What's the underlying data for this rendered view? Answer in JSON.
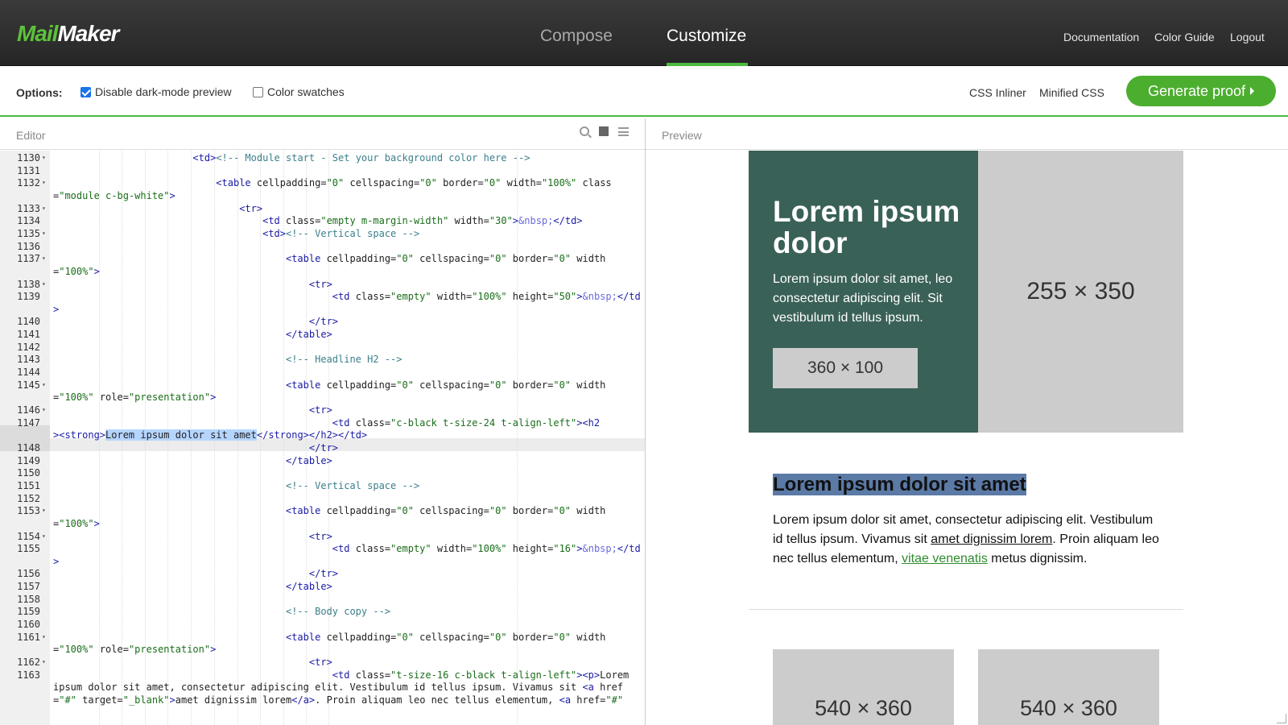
{
  "app": {
    "logo_part1": "Mail",
    "logo_part2": "Maker"
  },
  "nav": {
    "tabs": [
      {
        "label": "Compose",
        "active": false
      },
      {
        "label": "Customize",
        "active": true
      }
    ],
    "links": [
      "Documentation",
      "Color Guide",
      "Logout"
    ]
  },
  "options": {
    "label": "Options:",
    "disable_dark": {
      "label": "Disable dark-mode preview",
      "checked": true
    },
    "color_swatches": {
      "label": "Color swatches",
      "checked": false
    },
    "css_inliner": "CSS Inliner",
    "minified_css": "Minified CSS",
    "generate": "Generate proof"
  },
  "editor": {
    "title": "Editor"
  },
  "preview": {
    "title": "Preview",
    "hero_title": "Lorem ipsum dolor",
    "hero_text": "Lorem ipsum dolor sit amet, leo consectetur adipiscing elit. Sit vestibulum id tellus ipsum.",
    "hero_button_placeholder": "360 × 100",
    "hero_image_placeholder": "255 × 350",
    "headline": "Lorem ipsum dolor sit amet",
    "body_part1": "Lorem ipsum dolor sit amet, consectetur adipiscing elit. Vestibulum id tellus ipsum. Vivamus sit ",
    "body_link1": "amet dignissim lorem",
    "body_part2": ". Proin aliquam leo nec tellus elementum, ",
    "body_link2": "vitae venenatis",
    "body_part3": " metus dignissim.",
    "card1": "540 × 360",
    "card2": "540 × 360"
  },
  "colors": {
    "accent": "#4cbb3f",
    "hero_bg": "#3a6157",
    "placeholder_bg": "#cccccc"
  }
}
